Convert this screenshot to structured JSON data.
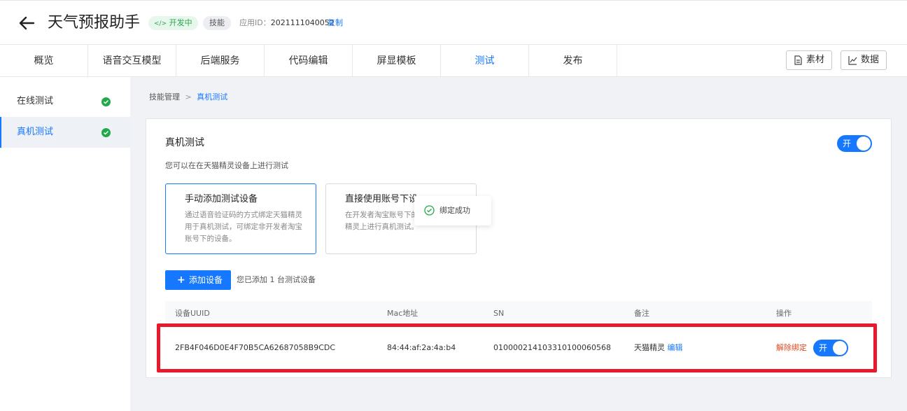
{
  "header": {
    "title": "天气预报助手",
    "status_badge": "开发中",
    "type_badge": "技能",
    "appid_label": "应用ID：",
    "appid_value": "2021111040052",
    "copy_label": "复制"
  },
  "tabs": [
    "概览",
    "语音交互模型",
    "后端服务",
    "代码编辑",
    "屏显模板",
    "测试",
    "发布"
  ],
  "active_tab": "测试",
  "toolbar": {
    "materials_label": "素材",
    "data_label": "数据"
  },
  "sidebar": {
    "items": [
      {
        "label": "在线测试",
        "done": true
      },
      {
        "label": "真机测试",
        "done": true
      }
    ]
  },
  "breadcrumb": {
    "parent": "技能管理",
    "separator": ">",
    "current": "真机测试"
  },
  "panel": {
    "title": "真机测试",
    "description": "您可以在在天猫精灵设备上进行测试",
    "toggle_label": "开",
    "options": [
      {
        "title": "手动添加测试设备",
        "description": "通过语音验证码的方式绑定天猫精灵用于真机测试，可绑定非开发者淘宝账号下的设备。"
      },
      {
        "title": "直接使用账号下设",
        "description": "在开发者淘宝账号下的天猫精灵上进行真机测试。"
      }
    ],
    "add_button": "添加设备",
    "count_text": "您已添加 1 台测试设备"
  },
  "toast": {
    "text": "绑定成功"
  },
  "table": {
    "columns": [
      "设备UUID",
      "Mac地址",
      "SN",
      "备注",
      "操作"
    ],
    "rows": [
      {
        "uuid": "2FB4F046D0E4F70B5CA62687058B9CDC",
        "mac": "84:44:af:2a:4a:b4",
        "sn": "010000214103310100060568",
        "note": "天猫精灵",
        "edit": "编辑",
        "unbind": "解除绑定",
        "toggle": "开"
      }
    ]
  },
  "colors": {
    "accent": "#1677ff",
    "success": "#21a94a",
    "danger": "#e4481f",
    "highlight": "#e8192c"
  }
}
